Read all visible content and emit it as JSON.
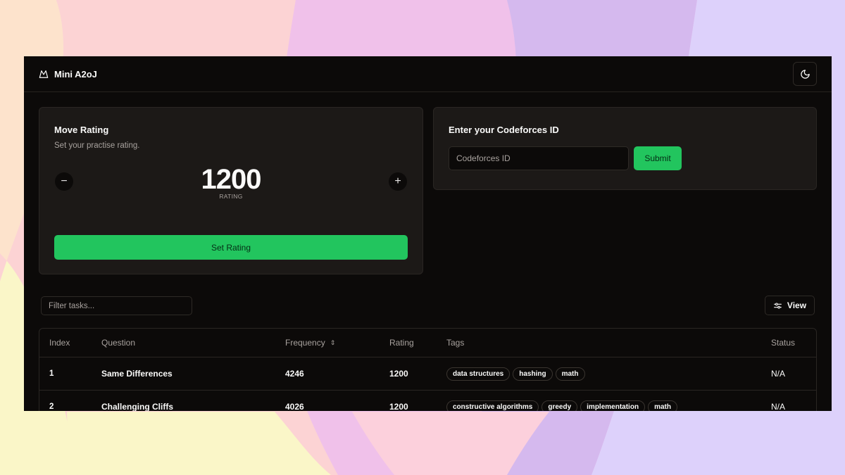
{
  "app": {
    "brand": "Mini A2oJ",
    "theme_icon": "moon-icon"
  },
  "rating_card": {
    "title": "Move Rating",
    "description": "Set your practise rating.",
    "value": "1200",
    "value_label": "RATING",
    "decrement": "−",
    "increment": "+",
    "set_button": "Set Rating"
  },
  "cf_card": {
    "title": "Enter your Codeforces ID",
    "input_placeholder": "Codeforces ID",
    "submit": "Submit"
  },
  "toolbar": {
    "filter_placeholder": "Filter tasks...",
    "view_label": "View"
  },
  "table": {
    "headers": {
      "index": "Index",
      "question": "Question",
      "frequency": "Frequency",
      "rating": "Rating",
      "tags": "Tags",
      "status": "Status"
    },
    "rows": [
      {
        "index": "1",
        "question": "Same Differences",
        "frequency": "4246",
        "rating": "1200",
        "tags": [
          "data structures",
          "hashing",
          "math"
        ],
        "status": "N/A"
      },
      {
        "index": "2",
        "question": "Challenging Cliffs",
        "frequency": "4026",
        "rating": "1200",
        "tags": [
          "constructive algorithms",
          "greedy",
          "implementation",
          "math"
        ],
        "status": "N/A"
      }
    ]
  },
  "colors": {
    "accent": "#22c55e",
    "surface": "#0c0a09",
    "card": "#1c1917"
  }
}
